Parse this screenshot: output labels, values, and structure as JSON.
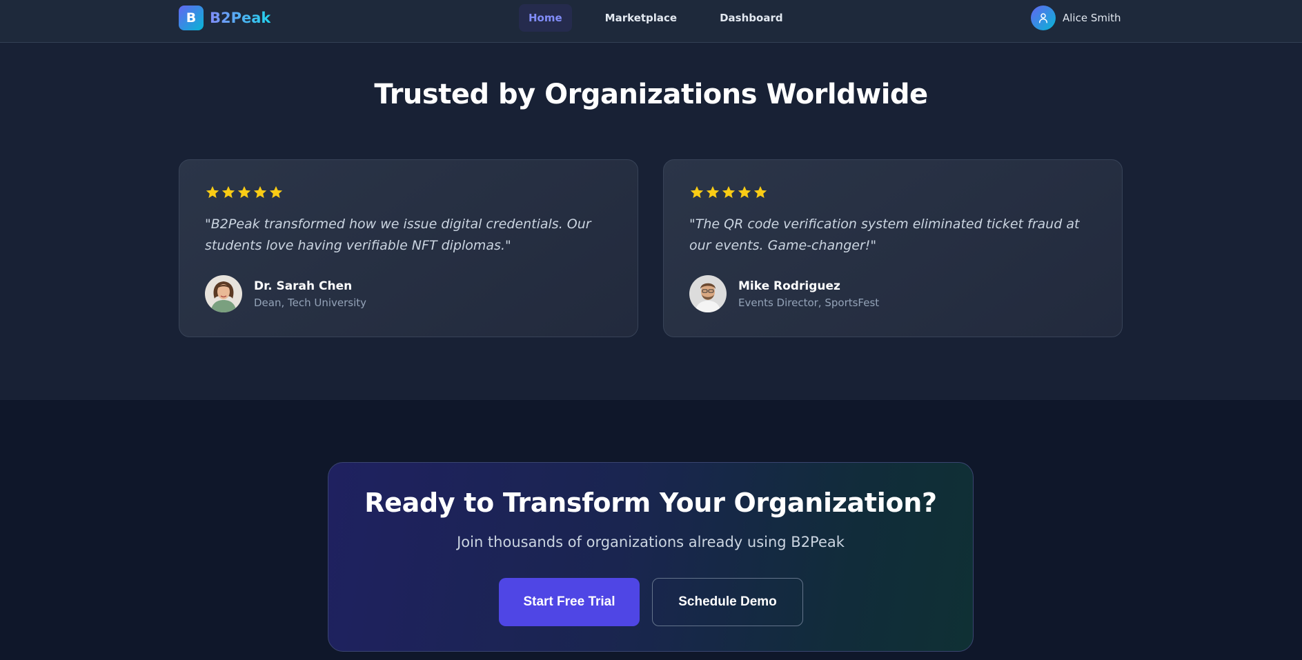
{
  "nav": {
    "logo_letter": "B",
    "brand": "B2Peak",
    "links": [
      {
        "label": "Home",
        "active": true
      },
      {
        "label": "Marketplace",
        "active": false
      },
      {
        "label": "Dashboard",
        "active": false
      }
    ],
    "user_name": "Alice Smith"
  },
  "testimonials": {
    "title": "Trusted by Organizations Worldwide",
    "items": [
      {
        "rating": 5,
        "quote": "\"B2Peak transformed how we issue digital credentials. Our students love having verifiable NFT diplomas.\"",
        "name": "Dr. Sarah Chen",
        "role": "Dean, Tech University"
      },
      {
        "rating": 5,
        "quote": "\"The QR code verification system eliminated ticket fraud at our events. Game-changer!\"",
        "name": "Mike Rodriguez",
        "role": "Events Director, SportsFest"
      }
    ]
  },
  "cta": {
    "title": "Ready to Transform Your Organization?",
    "subtitle": "Join thousands of organizations already using B2Peak",
    "primary_button": "Start Free Trial",
    "secondary_button": "Schedule Demo"
  },
  "colors": {
    "accent": "#4f46e5",
    "star": "#facc15",
    "background": "#0f172a"
  }
}
